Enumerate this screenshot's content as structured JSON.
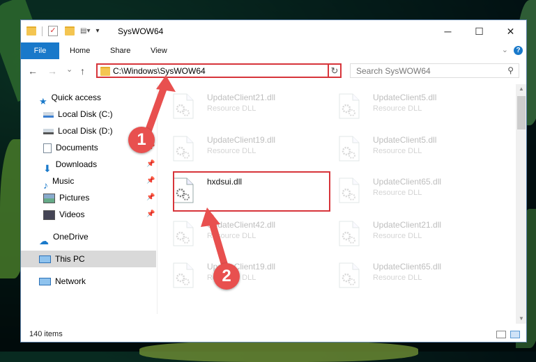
{
  "window": {
    "title": "SysWOW64",
    "controls": {
      "minimize": "─",
      "maximize": "☐",
      "close": "✕"
    }
  },
  "ribbon": {
    "tabs": [
      {
        "label": "File"
      },
      {
        "label": "Home"
      },
      {
        "label": "Share"
      },
      {
        "label": "View"
      }
    ],
    "help": "?"
  },
  "navbar": {
    "back": "←",
    "forward": "→",
    "recent": "⌄",
    "up": "↑",
    "address": "C:\\Windows\\SysWOW64",
    "search_placeholder": "Search SysWOW64",
    "refresh": "↻"
  },
  "sidebar": {
    "items": [
      {
        "label": "Quick access",
        "icon": "star-icon"
      },
      {
        "label": "Local Disk (C:)",
        "icon": "drive-icon"
      },
      {
        "label": "Local Disk (D:)",
        "icon": "drive-icon"
      },
      {
        "label": "Documents",
        "icon": "documents-icon"
      },
      {
        "label": "Downloads",
        "icon": "download-icon"
      },
      {
        "label": "Music",
        "icon": "music-icon"
      },
      {
        "label": "Pictures",
        "icon": "pictures-icon"
      },
      {
        "label": "Videos",
        "icon": "videos-icon"
      },
      {
        "label": "OneDrive",
        "icon": "cloud-icon"
      },
      {
        "label": "This PC",
        "icon": "computer-icon",
        "selected": true
      },
      {
        "label": "Network",
        "icon": "network-icon"
      }
    ]
  },
  "files": [
    {
      "name": "UpdateClient21.dll",
      "type": "Resource DLL"
    },
    {
      "name": "UpdateClient5.dll",
      "type": "Resource DLL"
    },
    {
      "name": "UpdateClient19.dll",
      "type": "Resource DLL"
    },
    {
      "name": "UpdateClient5.dll",
      "type": "Resource DLL"
    },
    {
      "name": "hxdsui.dll",
      "type": ""
    },
    {
      "name": "UpdateClient65.dll",
      "type": "Resource DLL"
    },
    {
      "name": "UpdateClient42.dll",
      "type": "Resource DLL"
    },
    {
      "name": "UpdateClient21.dll",
      "type": "Resource DLL"
    },
    {
      "name": "UpdateClient19.dll",
      "type": "Resource DLL"
    },
    {
      "name": "UpdateClient65.dll",
      "type": "Resource DLL"
    }
  ],
  "status": {
    "items_count": "140 items"
  },
  "annotations": {
    "step1": "1",
    "step2": "2"
  },
  "colors": {
    "accent": "#1979ca",
    "highlight": "#d7343a",
    "annotation": "#e8504f"
  }
}
